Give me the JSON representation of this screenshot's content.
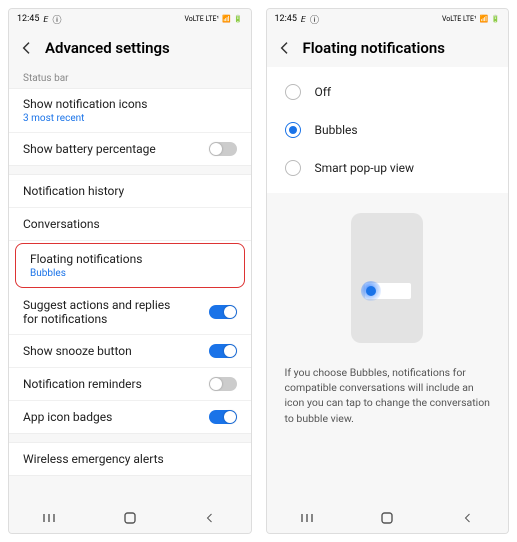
{
  "statusbar": {
    "time": "12:45",
    "net": "ⓘ",
    "mode_text": "𝘌",
    "right_small": "VoLTE LTE¹",
    "signal": "▮"
  },
  "left": {
    "title": "Advanced settings",
    "section_statusbar": "Status bar",
    "show_icons": {
      "label": "Show notification icons",
      "sub": "3 most recent"
    },
    "battery": {
      "label": "Show battery percentage"
    },
    "history": {
      "label": "Notification history"
    },
    "conversations": {
      "label": "Conversations"
    },
    "floating": {
      "label": "Floating notifications",
      "sub": "Bubbles"
    },
    "suggest": {
      "label": "Suggest actions and replies for notifications"
    },
    "snooze": {
      "label": "Show snooze button"
    },
    "reminders": {
      "label": "Notification reminders"
    },
    "badges": {
      "label": "App icon badges"
    },
    "emergency": {
      "label": "Wireless emergency alerts"
    }
  },
  "right": {
    "title": "Floating notifications",
    "options": {
      "off": "Off",
      "bubbles": "Bubbles",
      "smart": "Smart pop-up view"
    },
    "description": "If you choose Bubbles, notifications for compatible conversations will include an icon you can tap to change the conversation to bubble view."
  }
}
